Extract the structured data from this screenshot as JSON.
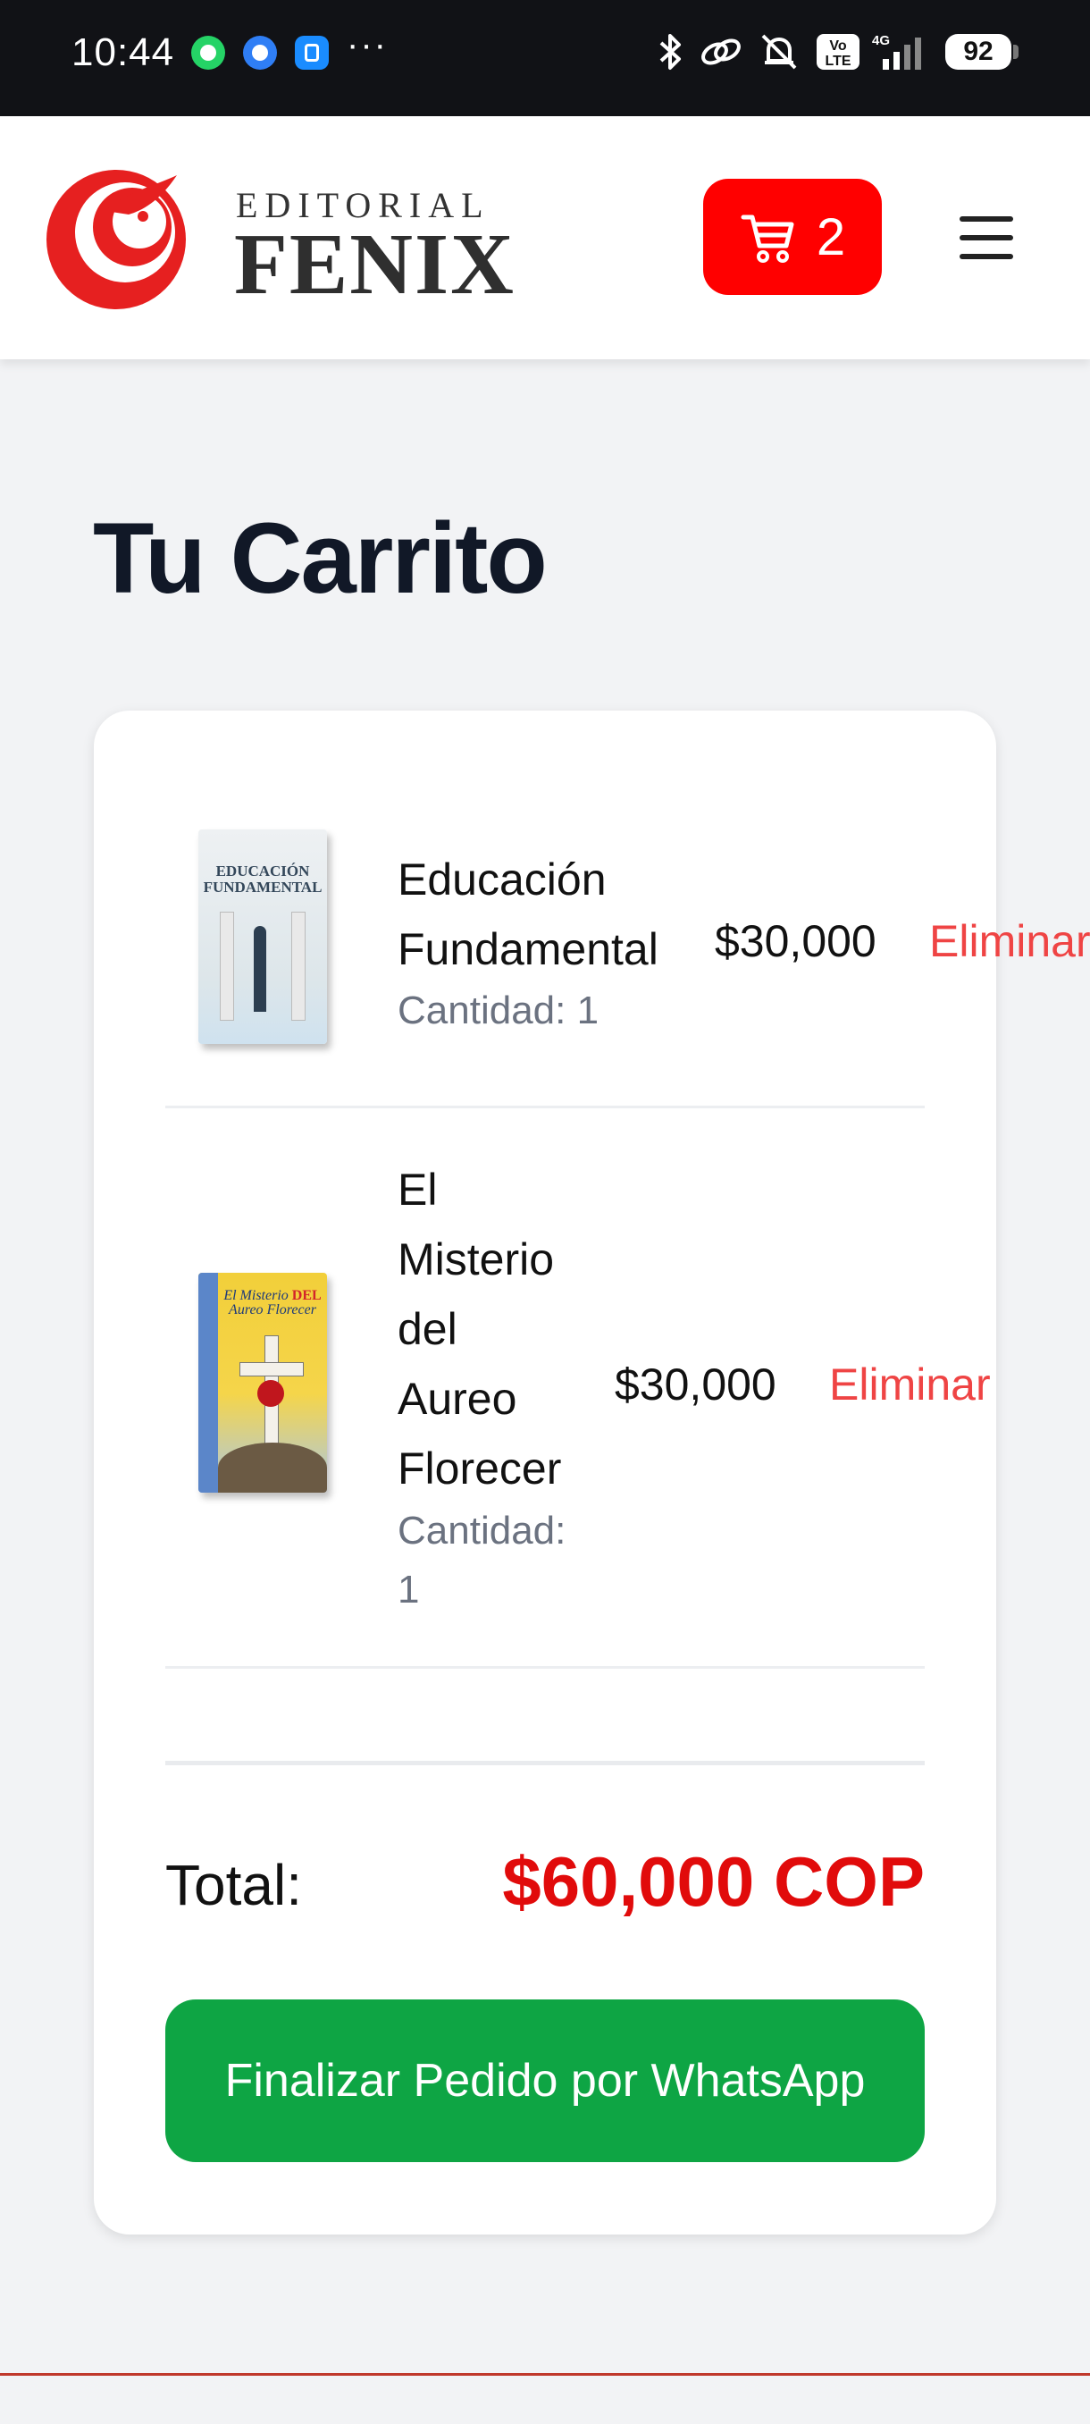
{
  "status_bar": {
    "time": "10:44",
    "more": "···",
    "battery": "92",
    "network": "4G",
    "volte": "Vo LTE"
  },
  "header": {
    "logo_top": "EDITORIAL",
    "logo_bottom": "FENIX",
    "cart_count": "2",
    "brand_color": "#ff0000"
  },
  "page": {
    "title": "Tu Carrito"
  },
  "cart": {
    "items": [
      {
        "title_lines": [
          "Educación",
          "Fundamental"
        ],
        "quantity": "Cantidad: 1",
        "price": "$30,000",
        "remove_label": "Eliminar",
        "cover_text": [
          "EDUCACIÓN",
          "FUNDAMENTAL"
        ]
      },
      {
        "title_lines": [
          "El",
          "Misterio",
          "del",
          "Aureo",
          "Florecer"
        ],
        "quantity_lines": [
          "Cantidad:",
          "1"
        ],
        "price": "$30,000",
        "remove_label": "Eliminar",
        "cover_text": [
          "El",
          "Misterio",
          "DEL",
          "Aureo",
          "Florecer"
        ]
      }
    ],
    "total_label": "Total:",
    "total_value": "$60,000 COP",
    "checkout_label": "Finalizar Pedido por WhatsApp",
    "checkout_color": "#0ea544",
    "total_color": "#e10b0b",
    "remove_color": "#ef4444"
  }
}
